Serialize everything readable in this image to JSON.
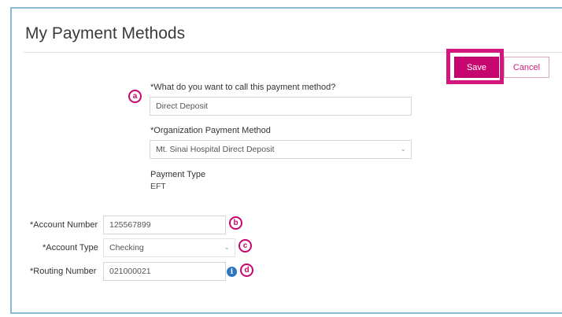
{
  "page": {
    "title": "My Payment Methods"
  },
  "toolbar": {
    "save_label": "Save",
    "cancel_label": "Cancel"
  },
  "form": {
    "name_field": {
      "required_mark": "*",
      "label": "What do you want to call this payment method?",
      "value": "Direct Deposit"
    },
    "org_method_field": {
      "required_mark": "*",
      "label": "Organization Payment Method",
      "value": "Mt. Sinai Hospital Direct Deposit"
    },
    "payment_type": {
      "label": "Payment Type",
      "value": "EFT"
    },
    "account_number": {
      "required_mark": "*",
      "label": "Account Number",
      "value": "125567899"
    },
    "account_type": {
      "required_mark": "*",
      "label": "Account Type",
      "value": "Checking"
    },
    "routing_number": {
      "required_mark": "*",
      "label": "Routing Number",
      "value": "021000021"
    }
  },
  "annotations": {
    "a": "a",
    "b": "b",
    "c": "c",
    "d": "d"
  },
  "icons": {
    "chevron": "chevron-down-icon",
    "info": "info-icon"
  },
  "colors": {
    "accent": "#c8066f",
    "highlight": "#d4177f",
    "info": "#2b77c0"
  }
}
